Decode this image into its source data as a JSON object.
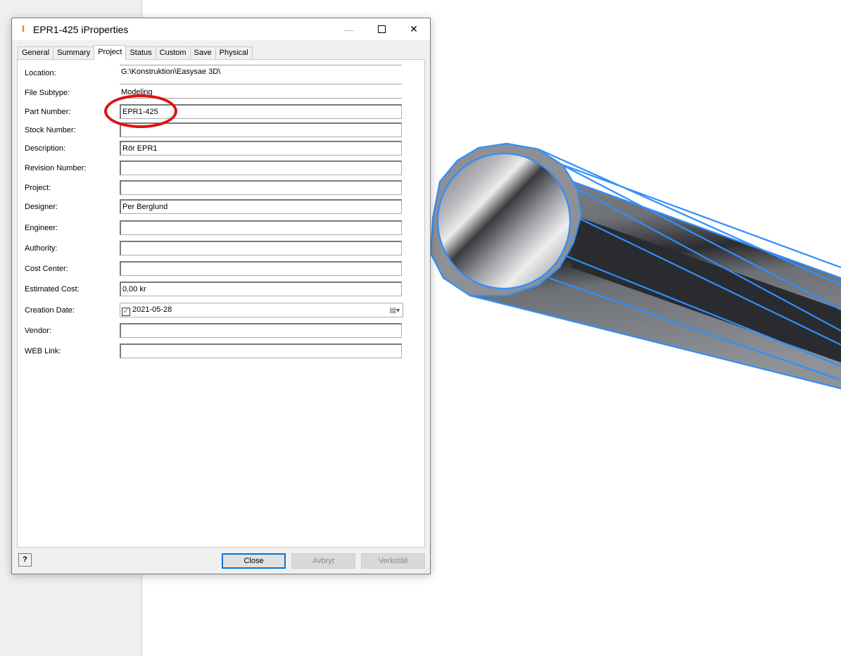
{
  "dialog": {
    "title": "EPR1-425 iProperties",
    "app_icon_glyph": "I",
    "minimize_glyph": "—",
    "close_glyph": "✕"
  },
  "tabs": [
    {
      "label": "General"
    },
    {
      "label": "Summary"
    },
    {
      "label": "Project",
      "active": true
    },
    {
      "label": "Status"
    },
    {
      "label": "Custom"
    },
    {
      "label": "Save"
    },
    {
      "label": "Physical"
    }
  ],
  "fields": {
    "location": {
      "label": "Location:",
      "value": "G:\\Konstruktion\\Easysae 3D\\"
    },
    "file_subtype": {
      "label": "File Subtype:",
      "value": "Modeling"
    },
    "part_number": {
      "label": "Part Number:",
      "value": "EPR1-425"
    },
    "stock_number": {
      "label": "Stock Number:",
      "value": ""
    },
    "description": {
      "label": "Description:",
      "value": "Rör EPR1"
    },
    "revision_number": {
      "label": "Revision Number:",
      "value": ""
    },
    "project": {
      "label": "Project:",
      "value": ""
    },
    "designer": {
      "label": "Designer:",
      "value": "Per Berglund"
    },
    "engineer": {
      "label": "Engineer:",
      "value": ""
    },
    "authority": {
      "label": "Authority:",
      "value": ""
    },
    "cost_center": {
      "label": "Cost Center:",
      "value": ""
    },
    "estimated_cost": {
      "label": "Estimated Cost:",
      "value": "0,00 kr"
    },
    "creation_date": {
      "label": "Creation Date:",
      "value": "2021-05-28",
      "checked": true
    },
    "vendor": {
      "label": "Vendor:",
      "value": ""
    },
    "web_link": {
      "label": "WEB Link:",
      "value": ""
    }
  },
  "buttons": {
    "help": "?",
    "close": "Close",
    "cancel": "Avbryt",
    "apply": "Verkställ"
  },
  "colors": {
    "highlight_ellipse": "#e01010",
    "edge_highlight": "#2f8fff"
  },
  "icons": {
    "app": "inventor-i-icon",
    "help": "help-icon",
    "calendar": "calendar-icon",
    "checkbox": "checkmark-icon"
  }
}
